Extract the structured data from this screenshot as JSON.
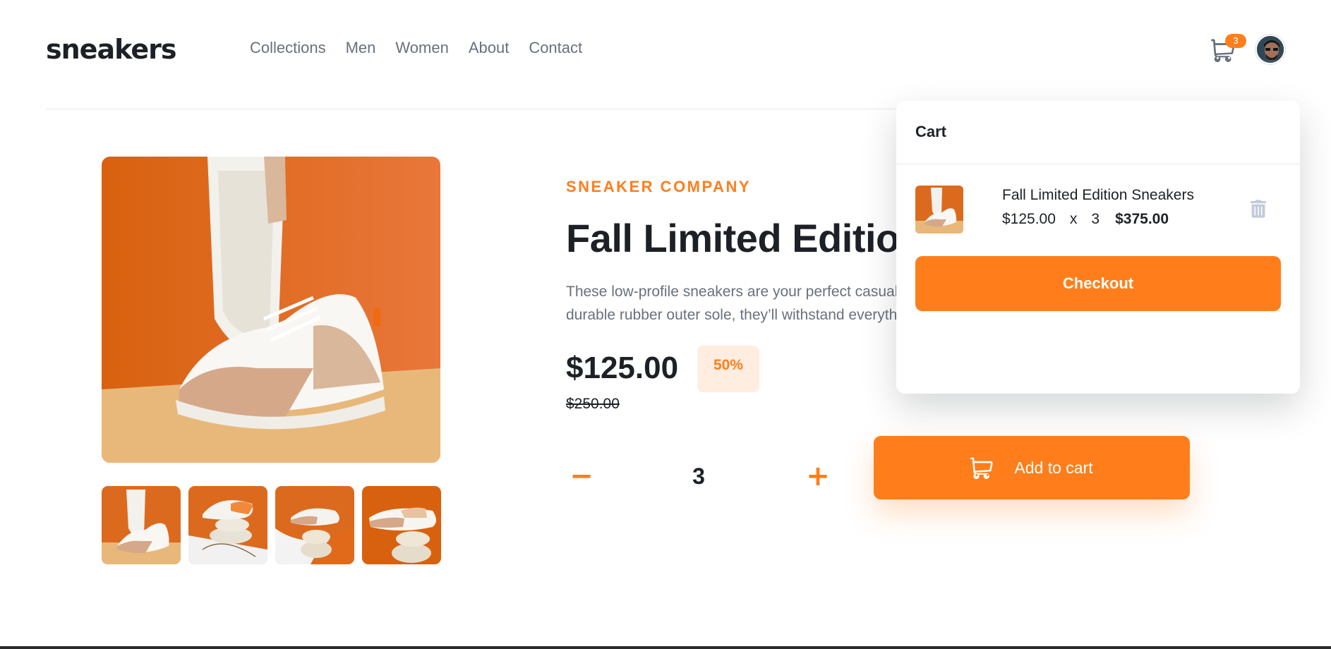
{
  "header": {
    "logo": "sneakers",
    "nav": [
      "Collections",
      "Men",
      "Women",
      "About",
      "Contact"
    ],
    "cart_count": "3"
  },
  "product": {
    "brand": "SNEAKER COMPANY",
    "title": "Fall Limited Edition Sneakers",
    "description_line1": "These low-profile sneakers are your perfect casual wear companion. Featuring a",
    "description_line2": "durable rubber outer sole, they’ll withstand everything the weather can offer.",
    "price": "$125.00",
    "discount": "50%",
    "old_price": "$250.00",
    "quantity": "3",
    "minus": "−",
    "plus": "+",
    "add_to_cart": "Add to cart"
  },
  "cart": {
    "title": "Cart",
    "item": {
      "name": "Fall Limited Edition Sneakers",
      "unit_price": "$125.00",
      "times": "x",
      "quantity": "3",
      "total": "$375.00"
    },
    "checkout": "Checkout"
  },
  "colors": {
    "accent": "#ff7e1b",
    "accent_light": "#ffede0",
    "text_dark": "#1d2026",
    "text_muted": "#69707d"
  },
  "icons": {
    "cart": "cart-icon",
    "delete": "trash-icon"
  }
}
